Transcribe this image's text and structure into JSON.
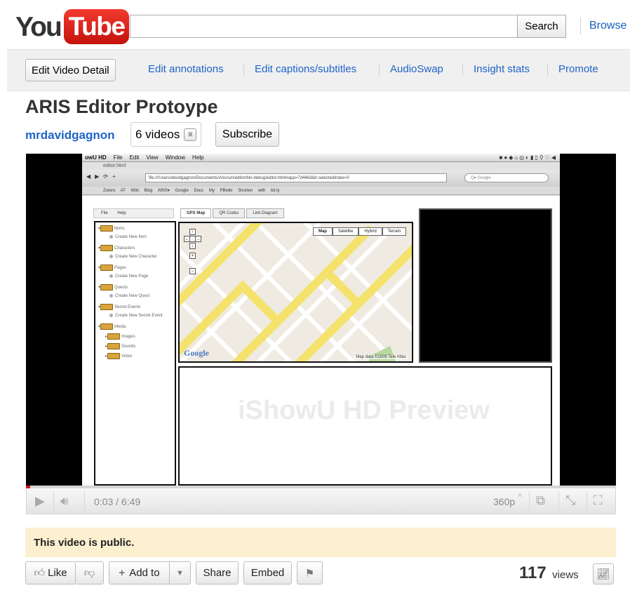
{
  "header": {
    "logo_you": "You",
    "logo_tube": "Tube",
    "search_value": "",
    "search_button": "Search",
    "browse": "Browse"
  },
  "owner_bar": {
    "edit_video_detail": "Edit Video Detail",
    "links": [
      "Edit annotations",
      "Edit captions/subtitles",
      "AudioSwap",
      "Insight stats",
      "Promote"
    ]
  },
  "video_info": {
    "title": "ARIS Editor Protoype",
    "channel": "mrdavidgagnon",
    "videos_count": "6 videos",
    "subscribe": "Subscribe"
  },
  "player": {
    "time_current": "0:03",
    "time_total": "6:49",
    "time_display": "0:03 / 6:49",
    "quality": "360p",
    "progress_fraction": 0.0073
  },
  "screen": {
    "menubar_app": "owU HD",
    "menubar_items": [
      "File",
      "Edit",
      "View",
      "Window",
      "Help"
    ],
    "window_title": "editor.html",
    "url": "file:///Users/davidgagnon/Documents/Aris/svn/editor/bin-debug/editor.html#app=7d4463&tr-selectedIndex=0",
    "search_placeholder": "Q▾ Google",
    "bookmarks": "Zotero  AT Wiki  Blog  ARIS▾  Google Docs  My PBwiki  Shorten with bit.ly",
    "app_menu": "File  Help",
    "tree": [
      {
        "label": "Items",
        "type": "folder"
      },
      {
        "label": "Create New Item",
        "type": "item"
      },
      {
        "label": "Characters",
        "type": "folder"
      },
      {
        "label": "Create New Character",
        "type": "item"
      },
      {
        "label": "Pages",
        "type": "folder"
      },
      {
        "label": "Create New Page",
        "type": "item"
      },
      {
        "label": "Quests",
        "type": "folder"
      },
      {
        "label": "Create New Quest",
        "type": "item"
      },
      {
        "label": "Secret Events",
        "type": "folder"
      },
      {
        "label": "Create New Secret Event",
        "type": "item"
      },
      {
        "label": "Media",
        "type": "folder"
      },
      {
        "label": "Images",
        "type": "subfolder"
      },
      {
        "label": "Sounds",
        "type": "subfolder"
      },
      {
        "label": "Video",
        "type": "subfolder"
      }
    ],
    "map_tabs": [
      "GPS Map",
      "QR Codes",
      "Link Diagram"
    ],
    "map_types": [
      "Map",
      "Satellite",
      "Hybrid",
      "Terrain"
    ],
    "google_mark": "Google",
    "map_credit": "Map data ©2009 Tele Atlas",
    "watermark": "iShowU HD Preview"
  },
  "public_notice": "This video is public.",
  "actions": {
    "like": "Like",
    "add_to": "Add to",
    "share": "Share",
    "embed": "Embed"
  },
  "views": {
    "count": "117",
    "label": "views"
  },
  "colors": {
    "link": "#1e63c6",
    "youtube_red": "#e5221b",
    "notice_bg": "#fcf0d0",
    "progress_red": "#c71a1a"
  }
}
